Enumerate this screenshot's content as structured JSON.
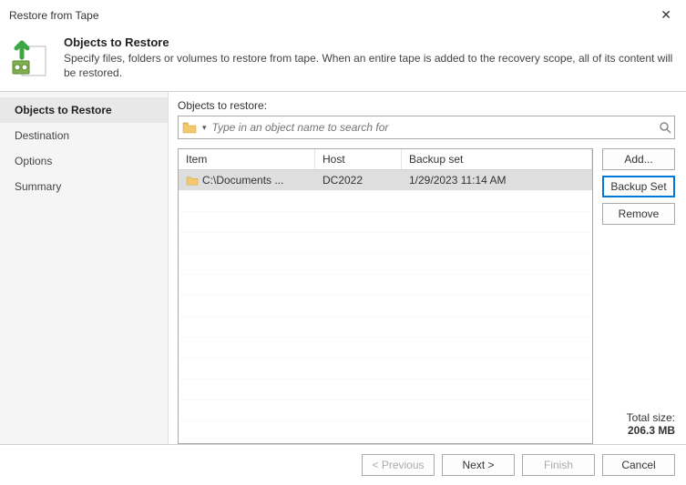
{
  "window": {
    "title": "Restore from Tape"
  },
  "header": {
    "title": "Objects to Restore",
    "description": "Specify files, folders or volumes to restore from tape. When an entire tape is added to the recovery scope, all of its content will be restored."
  },
  "sidebar": {
    "items": [
      {
        "label": "Objects to Restore",
        "active": true
      },
      {
        "label": "Destination",
        "active": false
      },
      {
        "label": "Options",
        "active": false
      },
      {
        "label": "Summary",
        "active": false
      }
    ]
  },
  "main": {
    "label": "Objects to restore:",
    "search": {
      "placeholder": "Type in an object name to search for"
    },
    "columns": {
      "item": "Item",
      "host": "Host",
      "backup": "Backup set"
    },
    "rows": [
      {
        "item": "C:\\Documents ...",
        "host": "DC2022",
        "backup": "1/29/2023 11:14 AM",
        "selected": true
      }
    ],
    "buttons": {
      "add": "Add...",
      "backup_set": "Backup Set",
      "remove": "Remove"
    },
    "totals": {
      "label": "Total size:",
      "value": "206.3 MB"
    }
  },
  "footer": {
    "previous": "< Previous",
    "next": "Next >",
    "finish": "Finish",
    "cancel": "Cancel"
  }
}
